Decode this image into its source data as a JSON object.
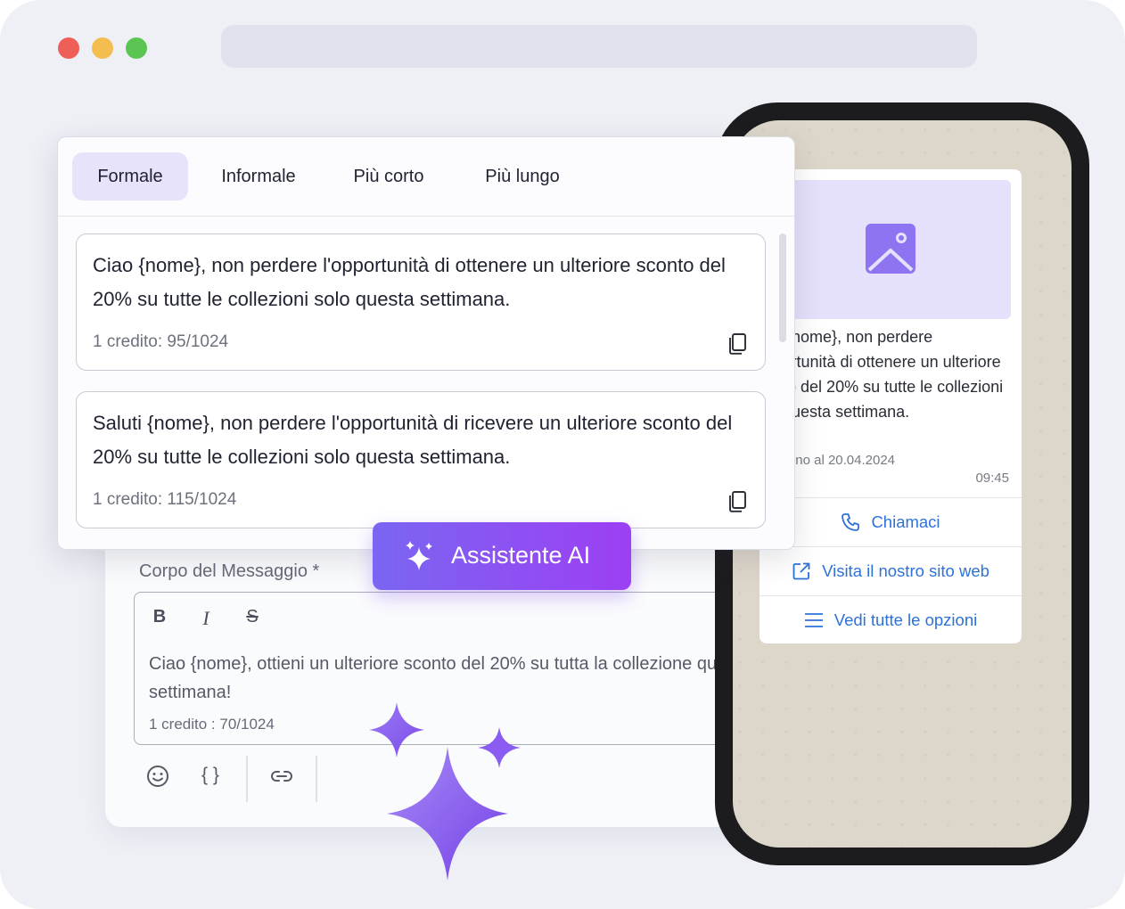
{
  "window": {
    "controls": [
      "close",
      "minimize",
      "maximize"
    ]
  },
  "tabs": [
    {
      "label": "Formale",
      "active": true
    },
    {
      "label": "Informale",
      "active": false
    },
    {
      "label": "Più corto",
      "active": false
    },
    {
      "label": "Più lungo",
      "active": false
    }
  ],
  "suggestions": [
    {
      "text": "Ciao {nome}, non perdere l'opportunità di ottenere un ulteriore sconto del 20% su tutte le collezioni solo questa settimana.",
      "counter": "1 credito: 95/1024"
    },
    {
      "text": "Saluti {nome}, non perdere l'opportunità di ricevere un ulteriore sconto del 20% su tutte le collezioni solo questa settimana.",
      "counter": "1 credito: 115/1024"
    }
  ],
  "ai_button": {
    "label": "Assistente AI",
    "icon": "sparkles-icon"
  },
  "editor": {
    "label": "Corpo del Messaggio *",
    "format_tools": [
      "B",
      "I",
      "S"
    ],
    "text": "Ciao {nome}, ottieni un ulteriore sconto del 20% su tutta la collezione questa settimana!",
    "counter": "1 credito : 70/1024",
    "toolbar_icons": [
      "emoji-icon",
      "variables-icon",
      "link-icon"
    ],
    "variables_glyph": "{ }"
  },
  "preview": {
    "message": "Ciao {nome}, non perdere l'opportunità di ottenere un ulteriore sconto del 20% su tutte le collezioni solo questa settimana.",
    "footer": "Valido fino al 20.04.2024",
    "time": "09:45",
    "buttons": [
      {
        "label": "Chiamaci",
        "icon": "phone-icon"
      },
      {
        "label": "Visita il nostro sito web",
        "icon": "external-link-icon"
      },
      {
        "label": "Vedi tutte le opzioni",
        "icon": "list-icon"
      }
    ]
  },
  "colors": {
    "accent": "#7c5cf5",
    "active_tab": "#e7e3fb",
    "link_blue": "#2d72d9",
    "phone_bezel": "#1c1c1e",
    "chat_bg": "#ddd6ca"
  }
}
